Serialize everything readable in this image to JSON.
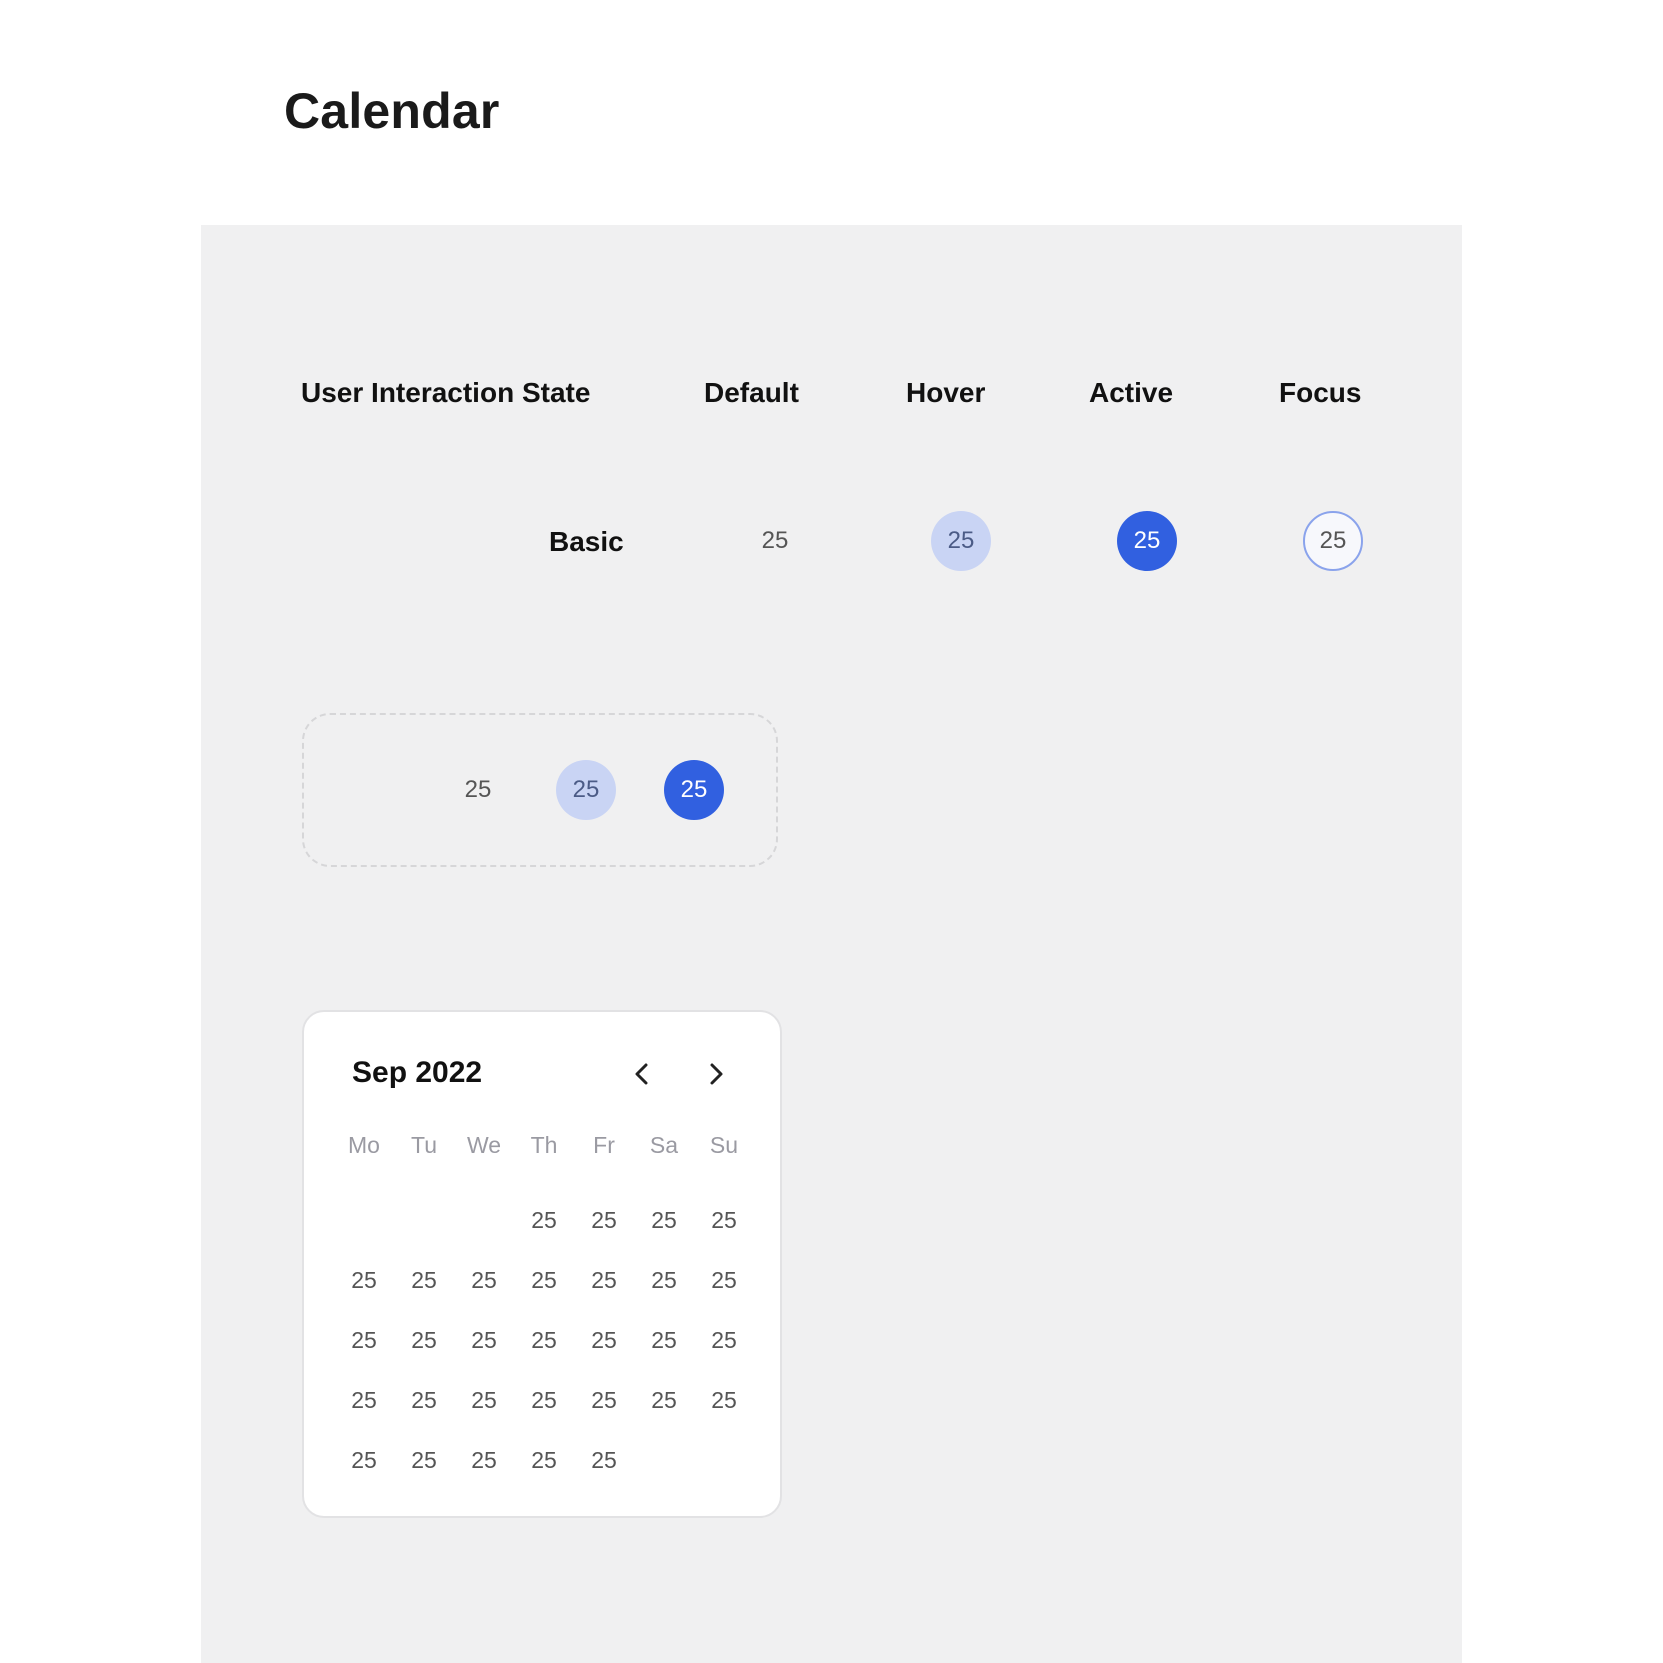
{
  "page": {
    "title": "Calendar"
  },
  "table": {
    "headers": {
      "state": "User Interaction State",
      "default": "Default",
      "hover": "Hover",
      "active": "Active",
      "focus": "Focus"
    },
    "rows": [
      {
        "label": "Basic",
        "default": "25",
        "hover": "25",
        "active": "25",
        "focus": "25"
      }
    ]
  },
  "range": {
    "default": "25",
    "hover": "25",
    "active": "25"
  },
  "calendar": {
    "month": "Sep 2022",
    "prev_icon": "chevron-left-icon",
    "next_icon": "chevron-right-icon",
    "weekdays": [
      "Mo",
      "Tu",
      "We",
      "Th",
      "Fr",
      "Sa",
      "Su"
    ],
    "weeks": [
      [
        "",
        "",
        "",
        "25",
        "25",
        "25",
        "25"
      ],
      [
        "25",
        "25",
        "25",
        "25",
        "25",
        "25",
        "25"
      ],
      [
        "25",
        "25",
        "25",
        "25",
        "25",
        "25",
        "25"
      ],
      [
        "25",
        "25",
        "25",
        "25",
        "25",
        "25",
        "25"
      ],
      [
        "25",
        "25",
        "25",
        "25",
        "25",
        "",
        ""
      ]
    ]
  },
  "colors": {
    "canvas": "#f0f0f1",
    "hover_fill": "#c9d4f4",
    "active_fill": "#3160e0",
    "focus_ring": "#8aa3ec",
    "weekday_text": "#9a9aa2",
    "date_text": "#555555"
  }
}
